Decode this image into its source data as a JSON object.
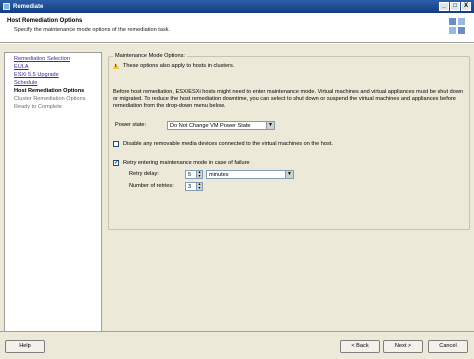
{
  "window": {
    "title": "Remediate",
    "controls": [
      "_",
      "□",
      "X"
    ]
  },
  "header": {
    "title": "Host Remediation Options",
    "subtitle": "Specify the maintenance mode options of the remediation task."
  },
  "nav": {
    "items": [
      {
        "label": "Remediation Selection",
        "state": "link"
      },
      {
        "label": "EULA",
        "state": "link"
      },
      {
        "label": "ESXi 5.5 Upgrade",
        "state": "link"
      },
      {
        "label": "Schedule",
        "state": "link"
      },
      {
        "label": "Host Remediation Options",
        "state": "current"
      },
      {
        "label": "Cluster Remediation Options",
        "state": "pending"
      },
      {
        "label": "Ready to Complete",
        "state": "pending"
      }
    ]
  },
  "maintenance": {
    "legend": "Maintenance Mode Options:",
    "warning": "These options also apply to hosts in clusters.",
    "description": "Before host remediation, ESX/ESXi hosts might need to enter maintenance mode. Virtual machines and virtual appliances must be shut down or migrated. To reduce the host remediation downtime, you can select to shut down or suspend the virtual machines and appliances before remediation from the drop-down menu below.",
    "power_state_label": "Power state:",
    "power_state_value": "Do Not Change VM Power State",
    "disable_media_label": "Disable any removable media devices connected to the virtual machines on the host.",
    "disable_media_checked": false,
    "retry_label": "Retry entering maintenance mode in case of failure",
    "retry_checked": true,
    "retry_delay_label": "Retry delay:",
    "retry_delay_value": "5",
    "retry_delay_unit": "minutes",
    "retries_label": "Number of retries:",
    "retries_value": "3"
  },
  "footer": {
    "help_label": "Help",
    "back_label": "< Back",
    "next_label": "Next >",
    "cancel_label": "Cancel"
  }
}
